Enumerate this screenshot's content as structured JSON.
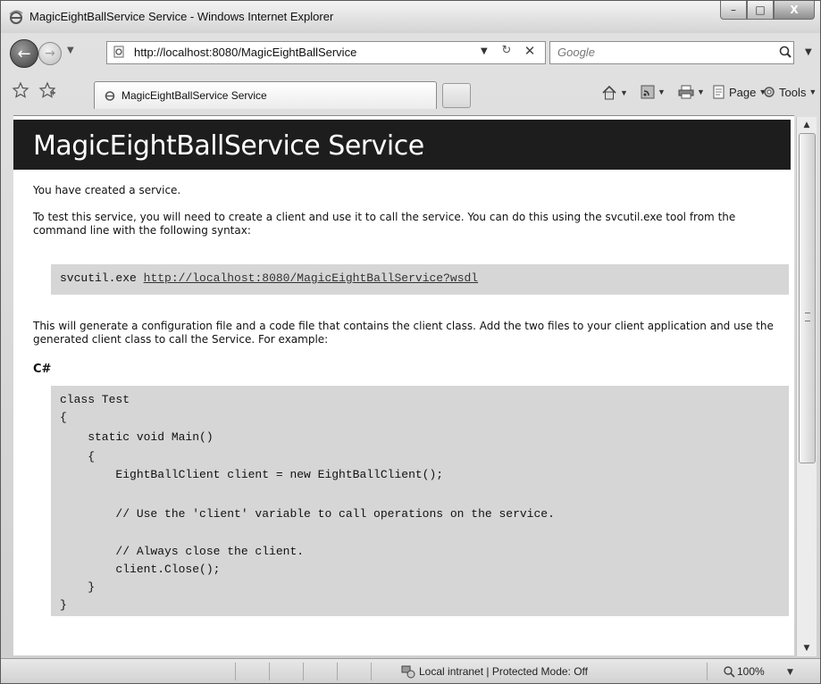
{
  "window": {
    "title": "MagicEightBallService Service - Windows Internet Explorer",
    "controls": {
      "minimize": "–",
      "maximize": "□",
      "close": "X"
    }
  },
  "navigation": {
    "address": "http://localhost:8080/MagicEightBallService",
    "search_placeholder": "Google"
  },
  "tab": {
    "label": "MagicEightBallService Service"
  },
  "commands": [
    {
      "label": "",
      "icon": "home-icon"
    },
    {
      "label": "",
      "icon": "feeds-icon"
    },
    {
      "label": "",
      "icon": "print-icon"
    },
    {
      "label": "Page",
      "icon": "page-icon"
    },
    {
      "label": "Tools",
      "icon": "tools-icon"
    }
  ],
  "page": {
    "heading": "MagicEightBallService Service",
    "created_text": "You have created a service.",
    "instructions": "To test this service, you will need to create a client and use it to call the service. You can do this using the svcutil.exe tool from the command line with the following syntax:",
    "svcutil_cmd": "svcutil.exe",
    "svcutil_url": "http://localhost:8080/MagicEightBallService?wsdl",
    "generate_text": "This will generate a configuration file and a code file that contains the client class. Add the two files to your client application and use the generated client class to call the Service. For example:",
    "language_label": "C#",
    "code_lines": [
      "class Test",
      "{",
      "    static void Main()",
      "    {",
      "        EightBallClient client = new EightBallClient();",
      "",
      "        // Use the 'client' variable to call operations on the service.",
      "",
      "        // Always close the client.",
      "        client.Close();",
      "    }",
      "}"
    ]
  },
  "status": {
    "zone": "Local intranet | Protected Mode: Off",
    "zoom": "100%"
  }
}
